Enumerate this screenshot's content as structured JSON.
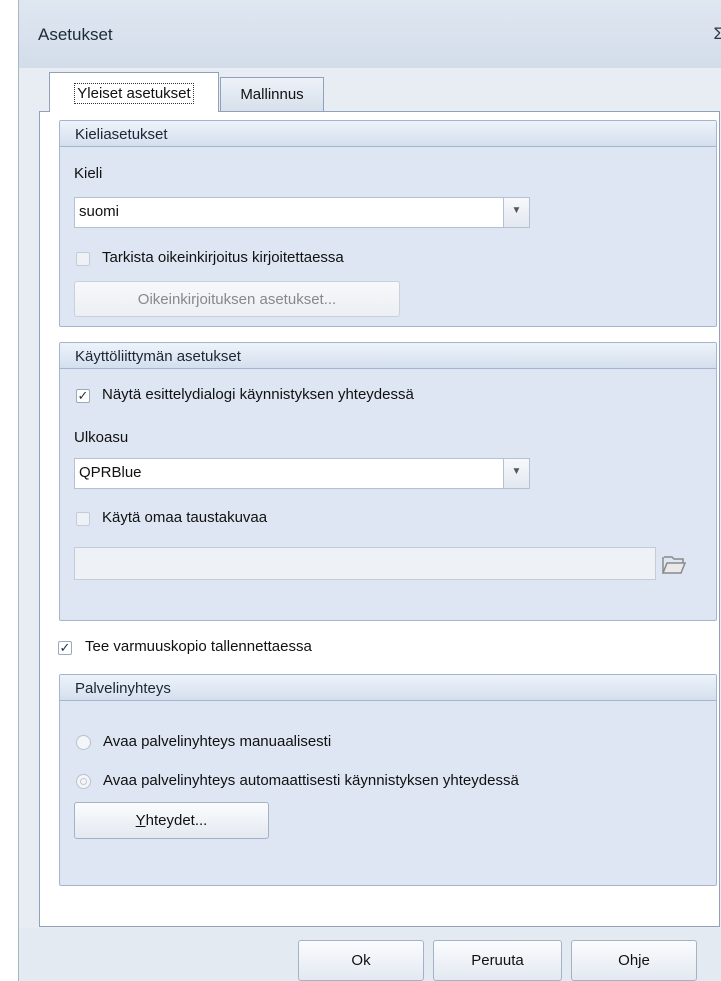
{
  "window": {
    "title": "Asetukset",
    "close_glyph": "Σ"
  },
  "tabs": [
    {
      "label": "Yleiset asetukset",
      "active": true
    },
    {
      "label": "Mallinnus",
      "active": false
    }
  ],
  "language": {
    "header": "Kieliasetukset",
    "field_label": "Kieli",
    "value": "suomi",
    "spellcheck_label": "Tarkista oikeinkirjoitus kirjoitettaessa",
    "spellcheck_checked": false,
    "spellcheck_settings_button": "Oikeinkirjoituksen asetukset..."
  },
  "ui": {
    "header": "Käyttöliittymän asetukset",
    "intro_label": "Näytä esittelydialogi käynnistyksen yhteydessä",
    "intro_checked": true,
    "skin_label": "Ulkoasu",
    "skin_value": "QPRBlue",
    "bg_label": "Käytä omaa taustakuvaa",
    "bg_checked": false,
    "bg_path": ""
  },
  "backup": {
    "label": "Tee varmuuskopio tallennettaessa",
    "checked": true
  },
  "server": {
    "header": "Palvelinyhteys",
    "manual_label": "Avaa palvelinyhteys manuaalisesti",
    "auto_label": "Avaa palvelinyhteys automaattisesti käynnistyksen yhteydessä",
    "connections_hotkey": "Y",
    "connections_rest": "hteydet..."
  },
  "footer": {
    "ok": "Ok",
    "cancel": "Peruuta",
    "help": "Ohje"
  },
  "icons": {
    "dropdown": "chevron-down-icon",
    "folder": "folder-open-icon",
    "check": "checkmark-icon"
  }
}
